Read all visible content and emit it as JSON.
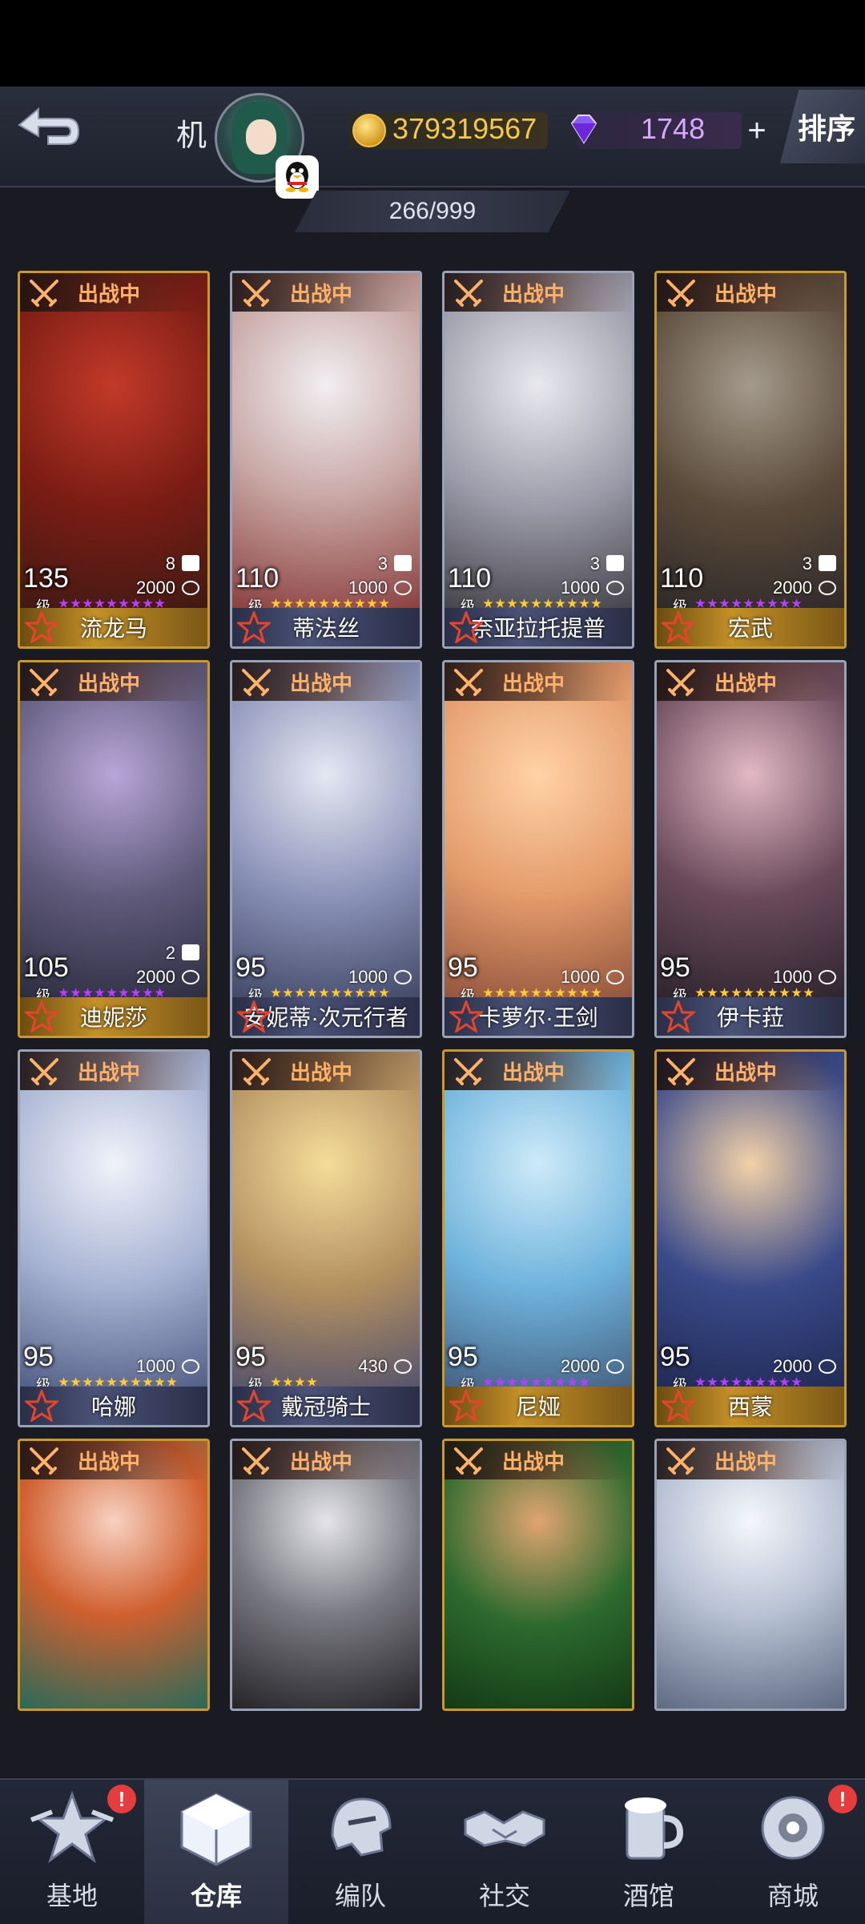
{
  "header": {
    "profile_name": "机",
    "gold": "379319567",
    "gems": "1748",
    "plus_label": "+",
    "sort_label": "排序",
    "capacity": "266/999"
  },
  "cards": [
    {
      "status": "出战中",
      "level": "135",
      "level_unit": "级",
      "power": "2000",
      "rank": "8",
      "stars": 9,
      "star_color": "#b640ff",
      "name": "流龙马",
      "frame": "gold",
      "bar": "gold"
    },
    {
      "status": "出战中",
      "level": "110",
      "level_unit": "级",
      "power": "1000",
      "rank": "3",
      "stars": 10,
      "star_color": "#ffcc33",
      "name": "蒂法丝",
      "frame": "silver",
      "bar": "blue"
    },
    {
      "status": "出战中",
      "level": "110",
      "level_unit": "级",
      "power": "1000",
      "rank": "3",
      "stars": 10,
      "star_color": "#ffcc33",
      "name": "奈亚拉托提普",
      "frame": "silver",
      "bar": "blue"
    },
    {
      "status": "出战中",
      "level": "110",
      "level_unit": "级",
      "power": "2000",
      "rank": "3",
      "stars": 9,
      "star_color": "#b640ff",
      "name": "宏武",
      "frame": "gold",
      "bar": "gold"
    },
    {
      "status": "出战中",
      "level": "105",
      "level_unit": "级",
      "power": "2000",
      "rank": "2",
      "stars": 9,
      "star_color": "#b640ff",
      "name": "迪妮莎",
      "frame": "gold",
      "bar": "gold"
    },
    {
      "status": "出战中",
      "level": "95",
      "level_unit": "级",
      "power": "1000",
      "rank": "",
      "stars": 10,
      "star_color": "#ffcc33",
      "name": "安妮蒂·次元行者",
      "frame": "silver",
      "bar": "blue"
    },
    {
      "status": "出战中",
      "level": "95",
      "level_unit": "级",
      "power": "1000",
      "rank": "",
      "stars": 10,
      "star_color": "#ffcc33",
      "name": "卡萝尔·王剑",
      "frame": "silver",
      "bar": "blue"
    },
    {
      "status": "出战中",
      "level": "95",
      "level_unit": "级",
      "power": "1000",
      "rank": "",
      "stars": 10,
      "star_color": "#ffcc33",
      "name": "伊卡菈",
      "frame": "silver",
      "bar": "blue"
    },
    {
      "status": "出战中",
      "level": "95",
      "level_unit": "级",
      "power": "1000",
      "rank": "",
      "stars": 10,
      "star_color": "#ffcc33",
      "name": "哈娜",
      "frame": "silver",
      "bar": "blue"
    },
    {
      "status": "出战中",
      "level": "95",
      "level_unit": "级",
      "power": "430",
      "rank": "",
      "stars": 4,
      "star_color": "#ffcc33",
      "name": "戴冠骑士",
      "frame": "silver",
      "bar": "blue"
    },
    {
      "status": "出战中",
      "level": "95",
      "level_unit": "级",
      "power": "2000",
      "rank": "",
      "stars": 9,
      "star_color": "#b640ff",
      "name": "尼娅",
      "frame": "gold",
      "bar": "gold"
    },
    {
      "status": "出战中",
      "level": "95",
      "level_unit": "级",
      "power": "2000",
      "rank": "",
      "stars": 9,
      "star_color": "#b640ff",
      "name": "西蒙",
      "frame": "gold",
      "bar": "gold"
    },
    {
      "status": "出战中",
      "level": "",
      "level_unit": "",
      "power": "",
      "rank": "",
      "stars": 0,
      "star_color": "#ffcc33",
      "name": "",
      "frame": "gold",
      "bar": "none"
    },
    {
      "status": "出战中",
      "level": "",
      "level_unit": "",
      "power": "",
      "rank": "",
      "stars": 0,
      "star_color": "#ffcc33",
      "name": "",
      "frame": "silver",
      "bar": "none"
    },
    {
      "status": "出战中",
      "level": "",
      "level_unit": "",
      "power": "",
      "rank": "",
      "stars": 0,
      "star_color": "#ffcc33",
      "name": "",
      "frame": "gold",
      "bar": "none"
    },
    {
      "status": "出战中",
      "level": "",
      "level_unit": "",
      "power": "",
      "rank": "",
      "stars": 0,
      "star_color": "#ffcc33",
      "name": "",
      "frame": "silver",
      "bar": "none"
    }
  ],
  "nav": [
    {
      "label": "基地",
      "alert": "!"
    },
    {
      "label": "仓库",
      "alert": ""
    },
    {
      "label": "编队",
      "alert": ""
    },
    {
      "label": "社交",
      "alert": ""
    },
    {
      "label": "酒馆",
      "alert": ""
    },
    {
      "label": "商城",
      "alert": "!"
    }
  ],
  "colors": {
    "accent_gold": "#f6c84a",
    "gem_violet": "#d8a8ff",
    "status_orange": "#ffb268",
    "alert_red": "#e53d3d"
  }
}
